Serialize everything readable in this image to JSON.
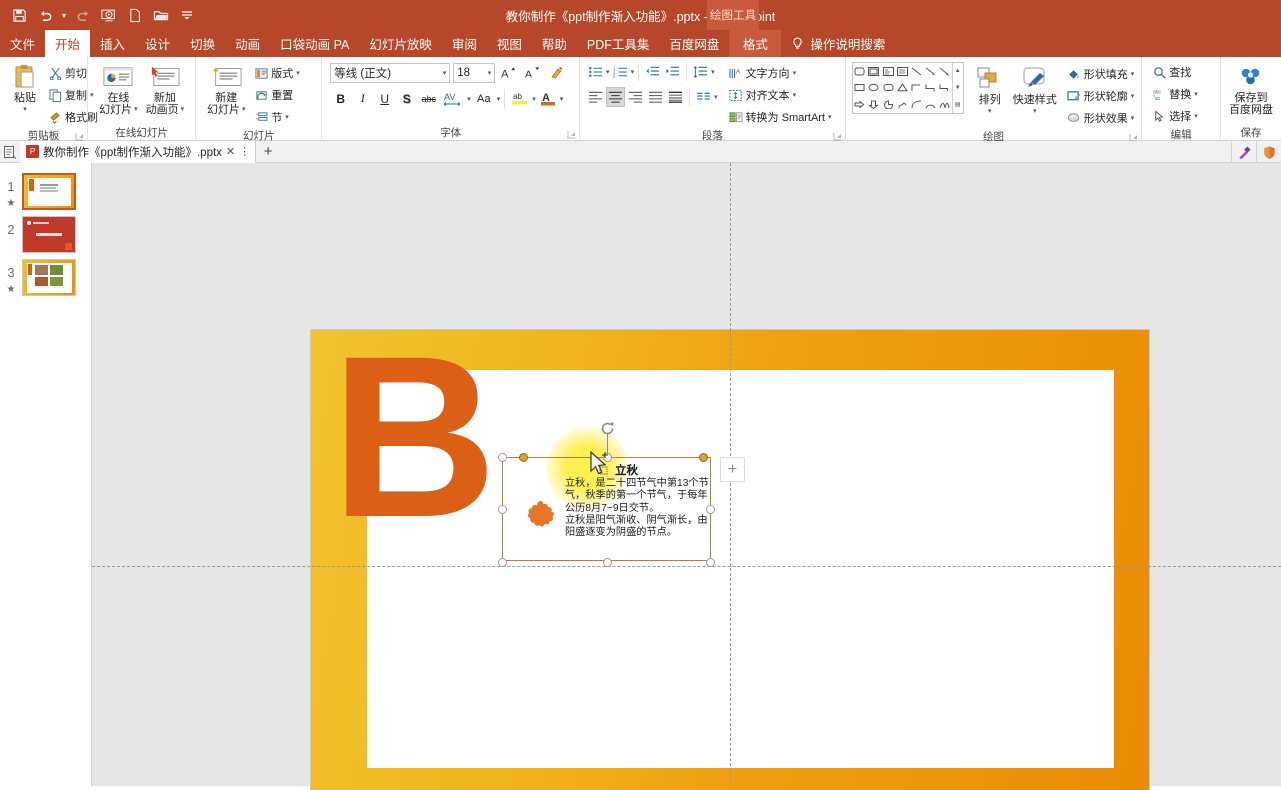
{
  "app": {
    "title": "教你制作《ppt制作渐入功能》.pptx  -  PowerPoint",
    "context_tab_group": "绘图工具",
    "accent": "#b7472a",
    "context_accent": "#c85a3d"
  },
  "quick_access": [
    {
      "name": "save-icon",
      "label": "保存"
    },
    {
      "name": "undo-icon",
      "label": "撤消"
    },
    {
      "name": "redo-icon",
      "label": "恢复"
    },
    {
      "name": "start-presentation-icon",
      "label": "从头开始"
    },
    {
      "name": "new-icon",
      "label": "新建"
    },
    {
      "name": "open-icon",
      "label": "打开"
    },
    {
      "name": "customize-qat-icon",
      "label": "自定义快速访问工具栏"
    }
  ],
  "tabs": [
    {
      "label": "文件",
      "active": false
    },
    {
      "label": "开始",
      "active": true
    },
    {
      "label": "插入",
      "active": false
    },
    {
      "label": "设计",
      "active": false
    },
    {
      "label": "切换",
      "active": false
    },
    {
      "label": "动画",
      "active": false
    },
    {
      "label": "口袋动画 PA",
      "active": false
    },
    {
      "label": "幻灯片放映",
      "active": false
    },
    {
      "label": "审阅",
      "active": false
    },
    {
      "label": "视图",
      "active": false
    },
    {
      "label": "帮助",
      "active": false
    },
    {
      "label": "PDF工具集",
      "active": false
    },
    {
      "label": "百度网盘",
      "active": false
    }
  ],
  "context_tab": {
    "label": "格式"
  },
  "tell_me": {
    "placeholder": "操作说明搜索"
  },
  "ribbon": {
    "groups": [
      {
        "name": "clipboard",
        "label": "剪贴板",
        "has_dialog_launcher": true,
        "paste": {
          "label": "粘贴"
        },
        "items": [
          {
            "label": "剪切",
            "icon": "scissors-icon"
          },
          {
            "label": "复制",
            "icon": "copy-icon",
            "has_caret": true
          },
          {
            "label": "格式刷",
            "icon": "format-painter-icon"
          }
        ]
      },
      {
        "name": "online-slides",
        "label": "在线幻灯片",
        "has_dialog_launcher": false,
        "items": [
          {
            "label_line1": "在线",
            "label_line2": "幻灯片",
            "icon": "online-slide-icon",
            "has_caret": true
          },
          {
            "label_line1": "新加",
            "label_line2": "动画页",
            "icon": "new-animation-page-icon",
            "has_caret": true
          }
        ]
      },
      {
        "name": "slides",
        "label": "幻灯片",
        "has_dialog_launcher": false,
        "items": [
          {
            "label_line1": "新建",
            "label_line2": "幻灯片",
            "icon": "new-slide-icon",
            "has_caret": true
          }
        ],
        "small_items": [
          {
            "label": "版式",
            "icon": "layout-icon",
            "has_caret": true
          },
          {
            "label": "重置",
            "icon": "reset-icon",
            "has_caret": false
          },
          {
            "label": "节",
            "icon": "section-icon",
            "has_caret": true
          }
        ]
      },
      {
        "name": "font",
        "label": "字体",
        "has_dialog_launcher": true,
        "font_name": {
          "value": "等线 (正文)"
        },
        "font_size": {
          "value": "18"
        },
        "buttons": [
          {
            "label": "A",
            "name": "increase-font-size-button"
          },
          {
            "label": "A",
            "name": "decrease-font-size-button"
          },
          {
            "label": "",
            "name": "clear-formatting-button"
          },
          {
            "label": "B",
            "name": "bold-button"
          },
          {
            "label": "I",
            "name": "italic-button"
          },
          {
            "label": "U",
            "name": "underline-button"
          },
          {
            "label": "S",
            "name": "shadow-button"
          },
          {
            "label": "abc",
            "name": "strikethrough-button"
          },
          {
            "label": "AV",
            "name": "character-spacing-button"
          },
          {
            "label": "Aa",
            "name": "change-case-button"
          },
          {
            "label": "ab",
            "name": "text-highlight-button"
          },
          {
            "label": "A",
            "name": "font-color-button"
          }
        ]
      },
      {
        "name": "paragraph",
        "label": "段落",
        "has_dialog_launcher": true,
        "items": [
          {
            "label": "文字方向",
            "icon": "text-direction-icon",
            "has_caret": true
          },
          {
            "label": "对齐文本",
            "icon": "align-text-icon",
            "has_caret": true
          },
          {
            "label": "转换为 SmartArt",
            "icon": "smartart-icon",
            "has_caret": true
          }
        ]
      },
      {
        "name": "drawing",
        "label": "绘图",
        "has_dialog_launcher": true,
        "arrange": {
          "label": "排列",
          "icon": "arrange-icon"
        },
        "quick_styles": {
          "label": "快速样式",
          "icon": "quick-styles-icon"
        },
        "items": [
          {
            "label": "形状填充",
            "icon": "shape-fill-icon",
            "has_caret": true
          },
          {
            "label": "形状轮廓",
            "icon": "shape-outline-icon",
            "has_caret": true
          },
          {
            "label": "形状效果",
            "icon": "shape-effects-icon",
            "has_caret": true
          }
        ]
      },
      {
        "name": "editing",
        "label": "编辑",
        "has_dialog_launcher": false,
        "items": [
          {
            "label": "查找",
            "icon": "search-icon",
            "has_caret": false
          },
          {
            "label": "替换",
            "icon": "replace-icon",
            "has_caret": true
          },
          {
            "label": "选择",
            "icon": "select-icon",
            "has_caret": true
          }
        ]
      },
      {
        "name": "baidu-save",
        "label": "保存",
        "has_dialog_launcher": false,
        "items": [
          {
            "label_line1": "保存到",
            "label_line2": "百度网盘",
            "icon": "baidu-netdisk-icon"
          }
        ]
      }
    ]
  },
  "doc_tabs": {
    "left_icon": "tab-list-icon",
    "tabs": [
      {
        "label": "教你制作《ppt制作渐入功能》.pptx",
        "icon": "powerpoint-file-icon",
        "close": "✕",
        "more": "⋮"
      }
    ],
    "new_tab": "+",
    "right_icons": [
      "magic-wand-icon",
      "shield-icon"
    ]
  },
  "thumbnails": [
    {
      "number": "1",
      "star": "★",
      "selected": true
    },
    {
      "number": "2",
      "star": "",
      "selected": false
    },
    {
      "number": "3",
      "star": "★",
      "selected": false
    }
  ],
  "slide": {
    "letter": "B",
    "selected_shape": {
      "title": "立秋",
      "body": "立秋，是二十四节气中第13个节气，秋季的第一个节气，于每年公历8月7~9日交节。\n立秋是阳气渐收、阴气渐长，由阳盛逐变为阴盛的节点。",
      "decoration_icon": "puzzle-piece-icon",
      "sun_icon": "sun-glow-icon",
      "rotate_handle": "rotate-icon"
    },
    "design_ideas_button": "+"
  },
  "colors": {
    "slide_orange": "#ea8c05",
    "slide_yellow": "#f2c230",
    "letter_orange": "#db6016",
    "handle_fill": "#e0a030",
    "selection_border": "#c07a3e"
  }
}
